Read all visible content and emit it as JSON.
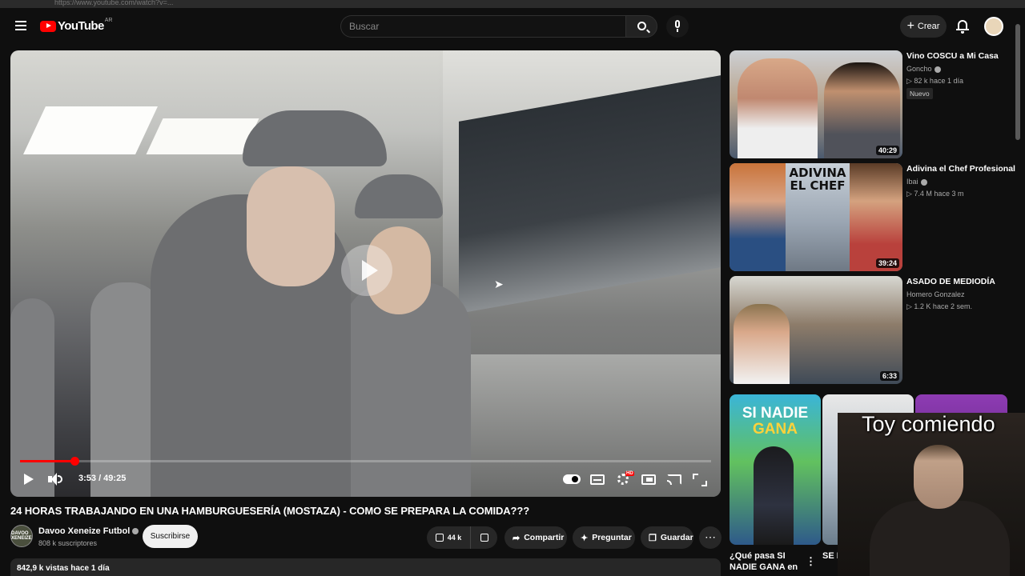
{
  "browser": {
    "url": "https://www.youtube.com/watch?v=..."
  },
  "header": {
    "logo_text": "YouTube",
    "region": "AR",
    "search_placeholder": "Buscar",
    "create_label": "Crear"
  },
  "player": {
    "current_time": "3:53",
    "duration": "49:25",
    "time_display": "3:53 / 49:25",
    "progress_fraction": 0.079
  },
  "video": {
    "title": "24 HORAS TRABAJANDO EN UNA HAMBURGUESERÍA (MOSTAZA) - COMO SE PREPARA LA COMIDA???",
    "channel_name": "Davoo Xeneize Futbol",
    "channel_avatar_text": "DAVOO XENEIZE",
    "subscribers": "808 k suscriptores",
    "subscribe_label": "Suscribirse",
    "likes": "44 k",
    "share_label": "Compartir",
    "ask_label": "Preguntar",
    "save_label": "Guardar",
    "views_line": "842,9 k vistas  hace 1 día"
  },
  "recommendations": [
    {
      "title": "Vino COSCU a Mi Casa",
      "channel": "Goncho",
      "meta": "▷ 82 k  hace 1 día",
      "badge": "Nuevo",
      "duration": "40:29"
    },
    {
      "title": "Adivina el Chef Profesional",
      "channel": "Ibai",
      "meta": "▷ 7.4 M  hace 3 m",
      "duration": "39:24",
      "thumb_text": "ADIVINA EL CHEF"
    },
    {
      "title": "ASADO DE MEDIODÍA",
      "channel": "Homero Gonzalez",
      "meta": "▷ 1.2 K  hace 2 sem.",
      "duration": "6:33"
    }
  ],
  "shorts": [
    {
      "thumb_text_1": "SI NADIE",
      "thumb_text_2": "GANA",
      "title": "¿Qué pasa SI NADIE GANA en ..."
    },
    {
      "title": "SE F SUP"
    }
  ],
  "webcam": {
    "caption": "Toy comiendo"
  },
  "colors": {
    "accent": "#ff0000",
    "background": "#0f0f0f",
    "pill": "#272727"
  }
}
